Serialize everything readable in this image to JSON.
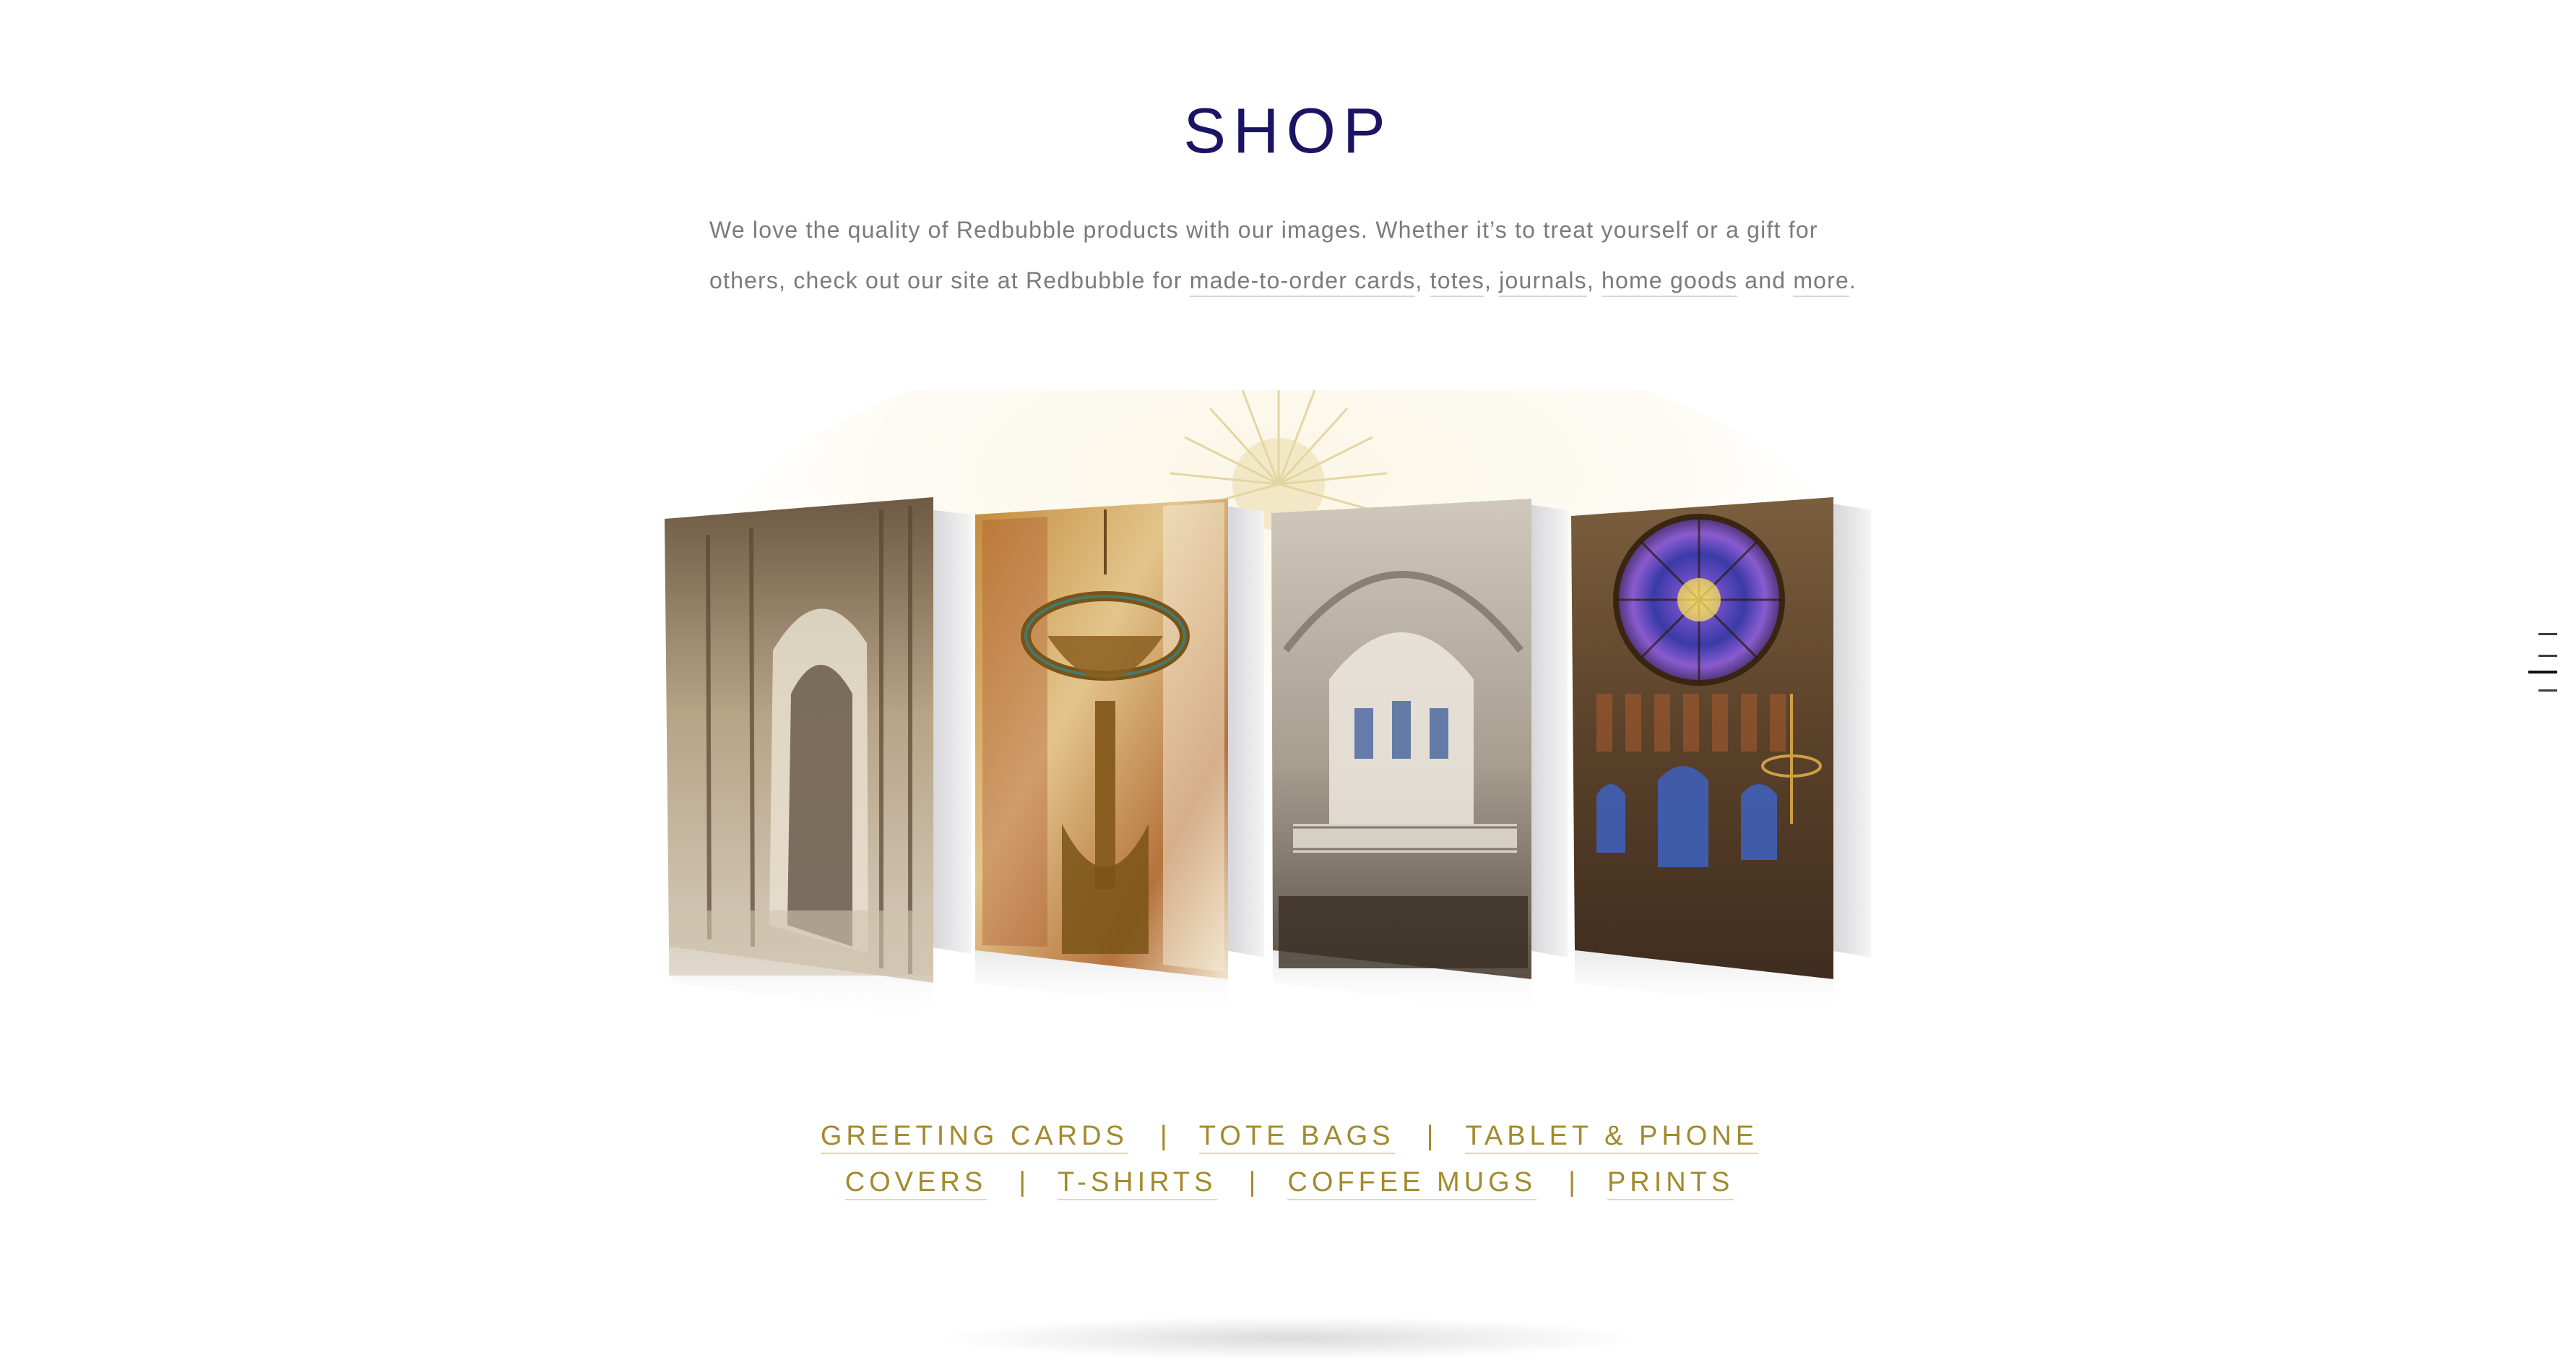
{
  "page": {
    "title": "SHOP"
  },
  "intro": {
    "line_part1": "We love the quality of Redbubble products with our images. Whether it’s to treat yourself or a gift for others, check out our site at Redbubble for ",
    "links": [
      {
        "label": "made-to-order cards"
      },
      {
        "label": "totes"
      },
      {
        "label": "journals"
      },
      {
        "label": "home goods"
      },
      {
        "label": "more"
      }
    ],
    "sep_comma": ", ",
    "sep_and": " and ",
    "period": "."
  },
  "graphic": {
    "cards": [
      {
        "subject": "cathedral-nave"
      },
      {
        "subject": "gold-chandelier"
      },
      {
        "subject": "gothic-church-interior"
      },
      {
        "subject": "rose-window"
      }
    ],
    "sunburst_color": "#e6d9a6"
  },
  "categories": {
    "items": [
      {
        "label": "GREETING CARDS"
      },
      {
        "label": "TOTE BAGS"
      },
      {
        "label": "TABLET & PHONE COVERS"
      },
      {
        "label": "T-SHIRTS"
      },
      {
        "label": "COFFEE MUGS"
      },
      {
        "label": "PRINTS"
      }
    ],
    "separator": "|"
  },
  "colors": {
    "title": "#1b1464",
    "body_text": "#7b7b7b",
    "category_gold": "#a38a2c"
  },
  "side_nav": {
    "icon": "section-nav-dashes-icon",
    "count": 4,
    "active_index": 1
  }
}
